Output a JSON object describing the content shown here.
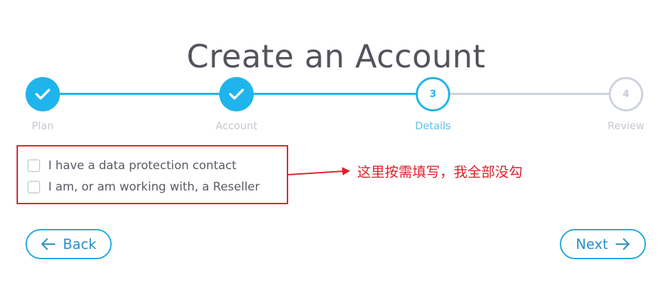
{
  "page": {
    "title": "Create an Account"
  },
  "wizard": {
    "steps": [
      {
        "label": "Plan",
        "number": "1",
        "status": "completed"
      },
      {
        "label": "Account",
        "number": "2",
        "status": "completed"
      },
      {
        "label": "Details",
        "number": "3",
        "status": "current"
      },
      {
        "label": "Review",
        "number": "4",
        "status": "upcoming"
      }
    ]
  },
  "options": [
    {
      "label": "I have a data protection contact",
      "checked": false
    },
    {
      "label": "I am, or am working with, a Reseller",
      "checked": false
    }
  ],
  "annotation": {
    "text": "这里按需填写，我全部没勾",
    "color": "#e0202a"
  },
  "nav": {
    "back_label": "Back",
    "next_label": "Next"
  },
  "colors": {
    "accent": "#20b4ec",
    "inactive": "#cdd3dd",
    "annotation": "#e0202a",
    "title": "#55525d"
  }
}
